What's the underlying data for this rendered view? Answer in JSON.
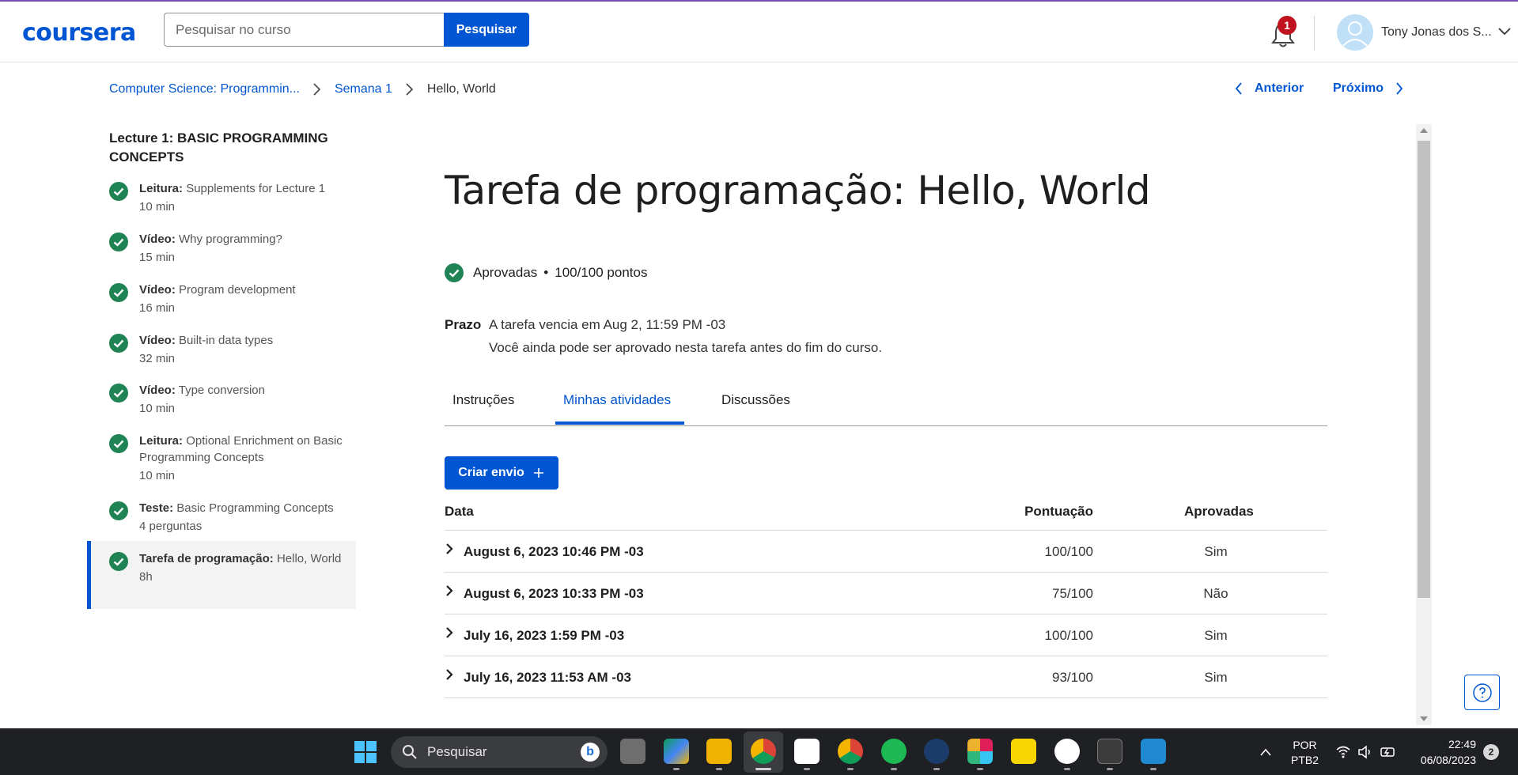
{
  "header": {
    "logo": "coursera",
    "search_placeholder": "Pesquisar no curso",
    "search_button": "Pesquisar",
    "notification_count": "1",
    "user_name": "Tony Jonas dos S...",
    "accent": "#0056d2"
  },
  "breadcrumb": {
    "course": "Computer Science: Programmin...",
    "week": "Semana 1",
    "current": "Hello, World"
  },
  "nav": {
    "prev": "Anterior",
    "next": "Próximo"
  },
  "sidebar": {
    "title": "Lecture 1: BASIC PROGRAMMING CONCEPTS",
    "items": [
      {
        "type": "Leitura:",
        "name": "Supplements for Lecture 1",
        "duration": "10 min"
      },
      {
        "type": "Vídeo:",
        "name": "Why programming?",
        "duration": "15 min"
      },
      {
        "type": "Vídeo:",
        "name": "Program development",
        "duration": "16 min"
      },
      {
        "type": "Vídeo:",
        "name": "Built-in data types",
        "duration": "32 min"
      },
      {
        "type": "Vídeo:",
        "name": "Type conversion",
        "duration": "10 min"
      },
      {
        "type": "Leitura:",
        "name": "Optional Enrichment on Basic Programming Concepts",
        "duration": "10 min"
      },
      {
        "type": "Teste:",
        "name": "Basic Programming Concepts",
        "duration": "4 perguntas"
      },
      {
        "type": "Tarefa de programação:",
        "name": "Hello, World",
        "duration": "8h"
      }
    ]
  },
  "main": {
    "title": "Tarefa de programação: Hello, World",
    "status": "Aprovadas",
    "points": "100/100 pontos",
    "deadline_label": "Prazo",
    "deadline_line1": "A tarefa vencia em Aug 2, 11:59 PM -03",
    "deadline_line2": "Você ainda pode ser aprovado nesta tarefa antes do fim do curso.",
    "tabs": [
      "Instruções",
      "Minhas atividades",
      "Discussões"
    ],
    "create_button": "Criar envio",
    "table": {
      "headers": [
        "Data",
        "Pontuação",
        "Aprovadas"
      ],
      "rows": [
        {
          "date": "August 6, 2023 10:46 PM -03",
          "score": "100/100",
          "passed": "Sim"
        },
        {
          "date": "August 6, 2023 10:33 PM -03",
          "score": "75/100",
          "passed": "Não"
        },
        {
          "date": "July 16, 2023 1:59 PM -03",
          "score": "100/100",
          "passed": "Sim"
        },
        {
          "date": "July 16, 2023 11:53 AM -03",
          "score": "93/100",
          "passed": "Sim"
        }
      ]
    }
  },
  "taskbar": {
    "search": "Pesquisar",
    "lang1": "POR",
    "lang2": "PTB2",
    "time": "22:49",
    "date": "06/08/2023",
    "notifications": "2"
  }
}
